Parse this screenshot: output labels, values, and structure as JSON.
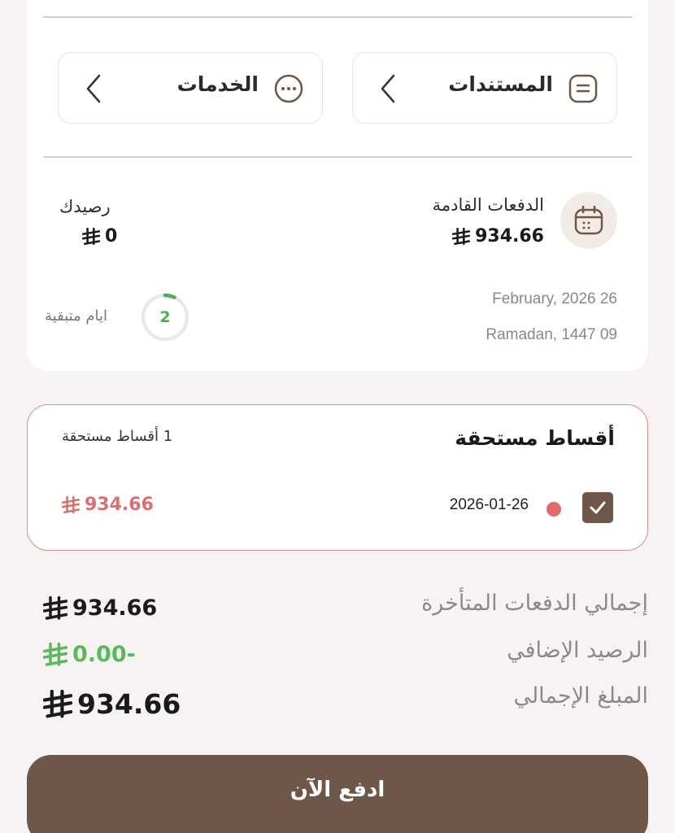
{
  "quick_actions": {
    "documents_label": "المستندات",
    "services_label": "الخدمات"
  },
  "summary": {
    "upcoming_label": "الدفعات القادمة",
    "upcoming_amount": "934.66",
    "balance_label": "رصيدك",
    "balance_amount": "0",
    "gregorian_date": "February, 2026 26",
    "hijri_date": "Ramadan, 1447 09",
    "days_remaining": "2",
    "days_remaining_label": "ايام متبقية",
    "days_progress_fraction": 0.07
  },
  "due_installments": {
    "title": "أقساط مستحقة",
    "count_text": "1 أقساط مستحقة",
    "items": [
      {
        "date": "2026-01-26",
        "amount": "934.66",
        "checked": true
      }
    ]
  },
  "totals": {
    "late_label": "إجمالي الدفعات المتأخرة",
    "late_amount": "934.66",
    "extra_label": "الرصيد الإضافي",
    "extra_amount": "0.00-",
    "total_label": "المبلغ الإجمالي",
    "total_amount": "934.66"
  },
  "pay_button_label": "ادفع الآن",
  "colors": {
    "brand_brown": "#6e5649",
    "overdue_red": "#d96f6f",
    "credit_green": "#5cb85c",
    "progress_green": "#4cae4f"
  },
  "icons": {
    "currency": "saudi-riyal-icon",
    "documents": "document-icon",
    "services": "more-dots-icon",
    "calendar": "calendar-icon",
    "chevron": "chevron-left-icon",
    "check": "checkmark-icon"
  }
}
